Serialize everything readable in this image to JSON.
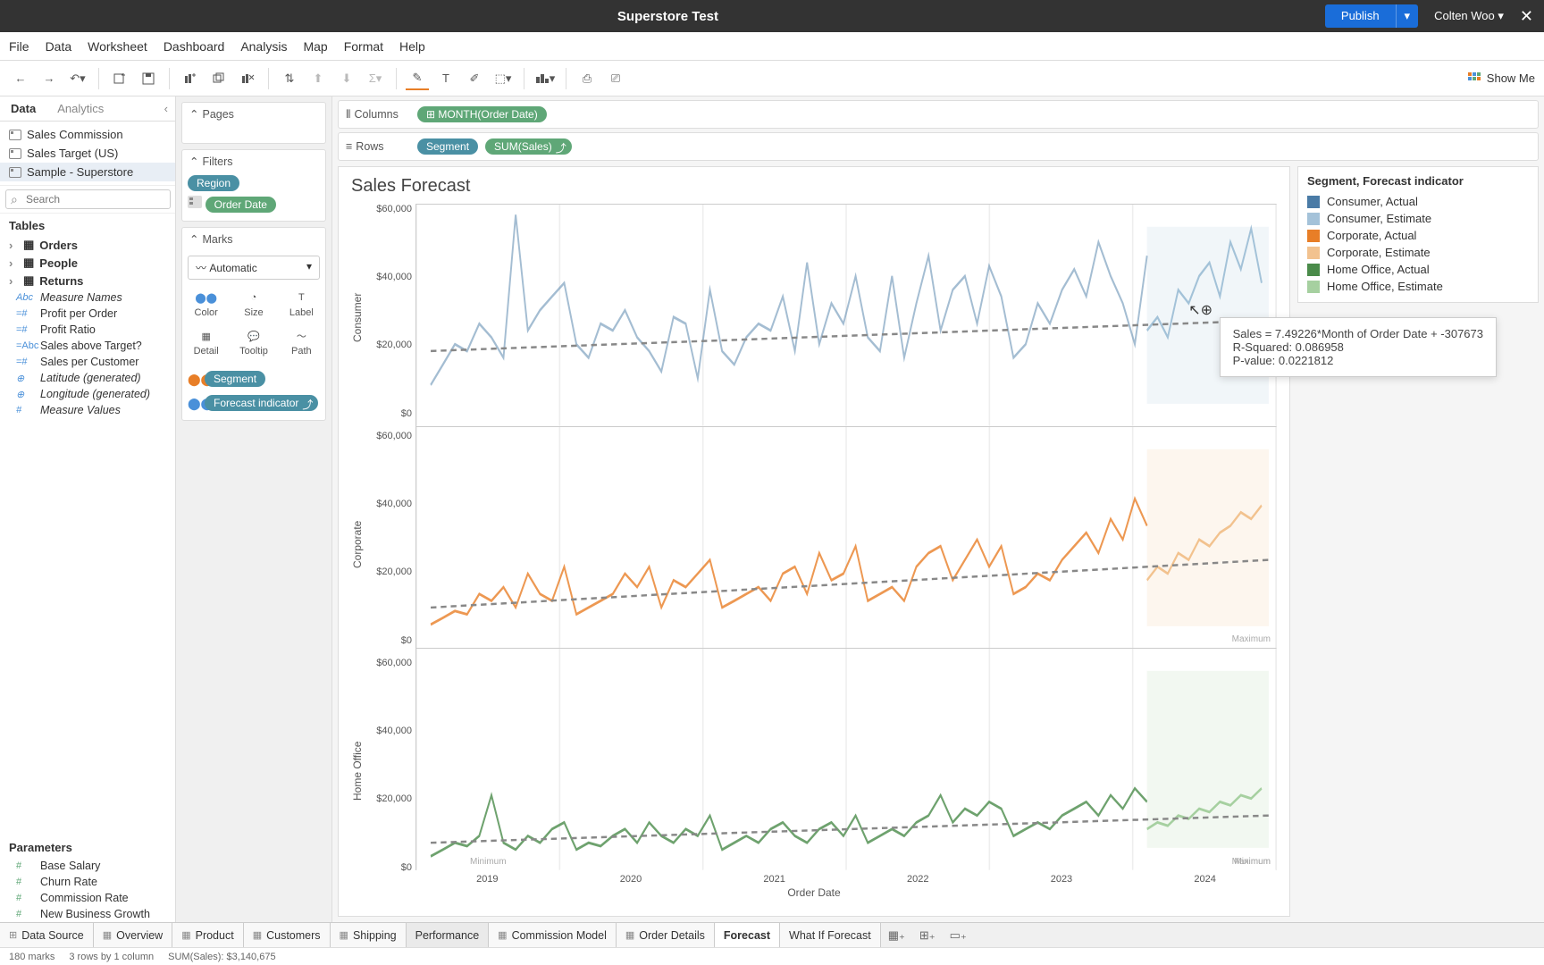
{
  "topbar": {
    "title": "Superstore Test",
    "publish": "Publish",
    "user": "Colten Woo"
  },
  "menu": [
    "File",
    "Data",
    "Worksheet",
    "Dashboard",
    "Analysis",
    "Map",
    "Format",
    "Help"
  ],
  "showme": "Show Me",
  "side": {
    "tabs": {
      "data": "Data",
      "analytics": "Analytics"
    },
    "sources": [
      "Sales Commission",
      "Sales Target (US)",
      "Sample - Superstore"
    ],
    "search_placeholder": "Search",
    "tables_h": "Tables",
    "folders": [
      "Orders",
      "People",
      "Returns"
    ],
    "fields": [
      {
        "icon": "Abc",
        "label": "Measure Names",
        "italic": true
      },
      {
        "icon": "=#",
        "label": "Profit per Order"
      },
      {
        "icon": "=#",
        "label": "Profit Ratio"
      },
      {
        "icon": "=Abc",
        "label": "Sales above Target?"
      },
      {
        "icon": "=#",
        "label": "Sales per Customer"
      },
      {
        "icon": "⊕",
        "label": "Latitude (generated)",
        "italic": true
      },
      {
        "icon": "⊕",
        "label": "Longitude (generated)",
        "italic": true
      },
      {
        "icon": "#",
        "label": "Measure Values",
        "italic": true
      }
    ],
    "params_h": "Parameters",
    "params": [
      "Base Salary",
      "Churn Rate",
      "Commission Rate",
      "New Business Growth"
    ]
  },
  "shelves": {
    "pages": "Pages",
    "filters": "Filters",
    "filter_pills": [
      {
        "label": "Region",
        "cls": "blue"
      },
      {
        "label": "Order Date",
        "cls": "green",
        "icon": true
      }
    ],
    "marks": "Marks",
    "marks_type": "Automatic",
    "mark_btns": [
      "Color",
      "Size",
      "Label",
      "Detail",
      "Tooltip",
      "Path"
    ],
    "mark_pills": [
      {
        "label": "Segment",
        "cls": "blue"
      },
      {
        "label": "Forecast indicator",
        "cls": "blue",
        "extra": true
      }
    ]
  },
  "colrow": {
    "columns": "Columns",
    "col_pill": "⊞ MONTH(Order Date)",
    "rows": "Rows",
    "row_pills": [
      {
        "label": "Segment",
        "cls": "blue"
      },
      {
        "label": "SUM(Sales)",
        "cls": "green",
        "extra": true
      }
    ]
  },
  "viz": {
    "title": "Sales Forecast",
    "panels": [
      "Consumer",
      "Corporate",
      "Home Office"
    ],
    "yticks": [
      "$60,000",
      "$40,000",
      "$20,000",
      "$0"
    ],
    "xticks": [
      "2019",
      "2020",
      "2021",
      "2022",
      "2023",
      "2024"
    ],
    "xlabel": "Order Date",
    "min_label": "Minimum",
    "max_label": "Maximum",
    "tooltip": {
      "l1": "Sales = 7.49226*Month of Order Date + -307673",
      "l2": "R-Squared: 0.086958",
      "l3": "P-value: 0.0221812"
    }
  },
  "legend": {
    "title": "Segment, Forecast indicator",
    "items": [
      {
        "color": "#4a7ba6",
        "label": "Consumer, Actual"
      },
      {
        "color": "#a4c2d9",
        "label": "Consumer, Estimate"
      },
      {
        "color": "#e87e27",
        "label": "Corporate, Actual"
      },
      {
        "color": "#f2c28f",
        "label": "Corporate, Estimate"
      },
      {
        "color": "#4a8b4a",
        "label": "Home Office, Actual"
      },
      {
        "color": "#a6d0a0",
        "label": "Home Office, Estimate"
      }
    ]
  },
  "tabs": [
    {
      "label": "Data Source",
      "icon": "db"
    },
    {
      "label": "Overview",
      "icon": "ws"
    },
    {
      "label": "Product",
      "icon": "ws"
    },
    {
      "label": "Customers",
      "icon": "ws"
    },
    {
      "label": "Shipping",
      "icon": "ws"
    },
    {
      "label": "Performance",
      "icon": "",
      "cls": "perf"
    },
    {
      "label": "Commission Model",
      "icon": "ws"
    },
    {
      "label": "Order Details",
      "icon": "ws"
    },
    {
      "label": "Forecast",
      "icon": "",
      "active": true
    },
    {
      "label": "What If Forecast",
      "icon": ""
    }
  ],
  "status": {
    "marks": "180 marks",
    "rc": "3 rows by 1 column",
    "sum": "SUM(Sales): $3,140,675"
  },
  "chart_data": {
    "type": "line",
    "title": "Sales Forecast",
    "xlabel": "Order Date",
    "ylabel": "SUM(Sales)",
    "x_range": [
      "2018-11",
      "2024-02"
    ],
    "ylim": [
      0,
      65000
    ],
    "panels": [
      {
        "segment": "Consumer",
        "series": [
          {
            "name": "Consumer, Actual",
            "color": "#4a7ba6",
            "values_approx": [
              12000,
              18000,
              24000,
              22000,
              30000,
              26000,
              20000,
              62000,
              28000,
              34000,
              38000,
              42000,
              24000,
              20000,
              30000,
              28000,
              34000,
              26000,
              22000,
              16000,
              32000,
              30000,
              14000,
              40000,
              22000,
              18000,
              26000,
              30000,
              28000,
              38000,
              22000,
              48000,
              24000,
              36000,
              30000,
              44000,
              26000,
              22000,
              44000,
              20000,
              36000,
              50000,
              28000,
              40000,
              44000,
              30000,
              47000,
              38000,
              20000,
              24000,
              36000,
              30000,
              40000,
              46000,
              38000,
              54000,
              44000,
              36000,
              24000,
              50000
            ]
          },
          {
            "name": "Consumer, Estimate",
            "color": "#a4c2d9",
            "months": [
              "2023-01",
              "2023-12"
            ],
            "values_approx": [
              28000,
              32000,
              26000,
              40000,
              36000,
              44000,
              48000,
              38000,
              54000,
              46000,
              58000,
              42000
            ]
          }
        ],
        "trend": {
          "equation": "Sales = 7.49226*Month of Order Date + -307673",
          "r2": 0.086958,
          "p": 0.0221812,
          "y_start": 22000,
          "y_end": 31000
        }
      },
      {
        "segment": "Corporate",
        "series": [
          {
            "name": "Corporate, Actual",
            "color": "#e87e27",
            "values_approx": [
              7000,
              9000,
              11000,
              10000,
              16000,
              14000,
              18000,
              12000,
              22000,
              16000,
              14000,
              24000,
              10000,
              12000,
              14000,
              16000,
              22000,
              18000,
              24000,
              12000,
              20000,
              18000,
              22000,
              26000,
              12000,
              14000,
              16000,
              18000,
              14000,
              22000,
              24000,
              16000,
              28000,
              20000,
              22000,
              30000,
              14000,
              16000,
              18000,
              14000,
              24000,
              28000,
              30000,
              20000,
              26000,
              32000,
              24000,
              30000,
              16000,
              18000,
              22000,
              20000,
              26000,
              30000,
              34000,
              28000,
              38000,
              32000,
              44000,
              36000
            ]
          },
          {
            "name": "Corporate, Estimate",
            "color": "#f2c28f",
            "months": [
              "2023-01",
              "2023-12"
            ],
            "values_approx": [
              20000,
              24000,
              22000,
              28000,
              26000,
              32000,
              30000,
              34000,
              36000,
              40000,
              38000,
              42000
            ]
          }
        ],
        "trend": {
          "y_start": 12000,
          "y_end": 26000
        },
        "ref_lines": [
          {
            "label": "Maximum",
            "y": 44000
          }
        ]
      },
      {
        "segment": "Home Office",
        "series": [
          {
            "name": "Home Office, Actual",
            "color": "#4a8b4a",
            "values_approx": [
              4000,
              6000,
              8000,
              7000,
              10000,
              22000,
              8000,
              6000,
              10000,
              8000,
              12000,
              14000,
              6000,
              8000,
              7000,
              10000,
              12000,
              8000,
              14000,
              10000,
              8000,
              12000,
              10000,
              16000,
              6000,
              8000,
              10000,
              8000,
              12000,
              14000,
              10000,
              8000,
              12000,
              14000,
              10000,
              16000,
              8000,
              10000,
              12000,
              10000,
              14000,
              16000,
              22000,
              14000,
              18000,
              16000,
              20000,
              18000,
              10000,
              12000,
              14000,
              12000,
              16000,
              18000,
              20000,
              16000,
              22000,
              18000,
              24000,
              20000
            ]
          },
          {
            "name": "Home Office, Estimate",
            "color": "#a6d0a0",
            "months": [
              "2023-01",
              "2023-12"
            ],
            "values_approx": [
              12000,
              14000,
              13000,
              16000,
              15000,
              18000,
              17000,
              20000,
              19000,
              22000,
              21000,
              24000
            ]
          }
        ],
        "trend": {
          "y_start": 8000,
          "y_end": 16000
        },
        "ref_lines": [
          {
            "label": "Minimum",
            "y": 4000
          },
          {
            "label": "Maximum",
            "y": 24000
          }
        ]
      }
    ],
    "x_ticks": [
      "2019",
      "2020",
      "2021",
      "2022",
      "2023",
      "2024"
    ]
  }
}
